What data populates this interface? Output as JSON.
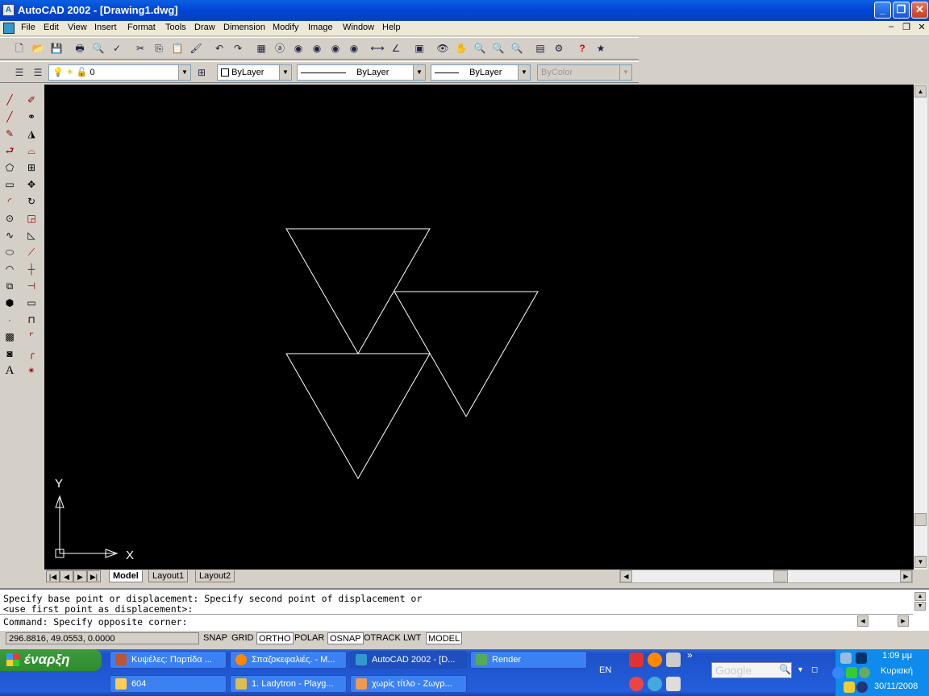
{
  "window": {
    "title": "AutoCAD 2002 - [Drawing1.dwg]",
    "icon": "autocad-icon"
  },
  "menu": [
    "File",
    "Edit",
    "View",
    "Insert",
    "Format",
    "Tools",
    "Draw",
    "Dimension",
    "Modify",
    "Image",
    "Window",
    "Help"
  ],
  "layers_toolbar": {
    "layer_value": "0",
    "color_value": "ByLayer",
    "linetype_value": "ByLayer",
    "lineweight_value": "ByLayer",
    "plotstyle_value": "ByColor"
  },
  "layout_tabs": [
    "Model",
    "Layout1",
    "Layout2"
  ],
  "ucs": {
    "x_label": "X",
    "y_label": "Y"
  },
  "command_lines": [
    "Specify base point or displacement: Specify second point of displacement or",
    "<use first point as displacement>:",
    "Command: Specify opposite corner:"
  ],
  "status": {
    "coordinates": "296.8816, 49.0553, 0.0000",
    "toggles": [
      "SNAP",
      "GRID",
      "ORTHO",
      "POLAR",
      "OSNAP",
      "OTRACK",
      "LWT",
      "MODEL"
    ],
    "on": [
      "ORTHO",
      "OSNAP",
      "MODEL"
    ]
  },
  "taskbar": {
    "start_label": "έναρξη",
    "tasks_row1": [
      "Κυψέλες: Παρτίδα ...",
      "Σπαζοκεφαλιές. - Μ...",
      "AutoCAD 2002 - [D...",
      "Render"
    ],
    "tasks_row2": [
      "604",
      "1. Ladytron - Playg...",
      "χωρίς τίτλο - Ζωγρ..."
    ],
    "active_task": "AutoCAD 2002 - [D...",
    "language": "EN",
    "search_placeholder": "Google",
    "overflow": "»"
  },
  "clock": {
    "time": "1:09 μμ",
    "day": "Κυριακή",
    "date": "30/11/2008"
  },
  "colors": {
    "canvas": "#000000",
    "xp_blue": "#245edb",
    "start_green": "#3c9c3c"
  }
}
